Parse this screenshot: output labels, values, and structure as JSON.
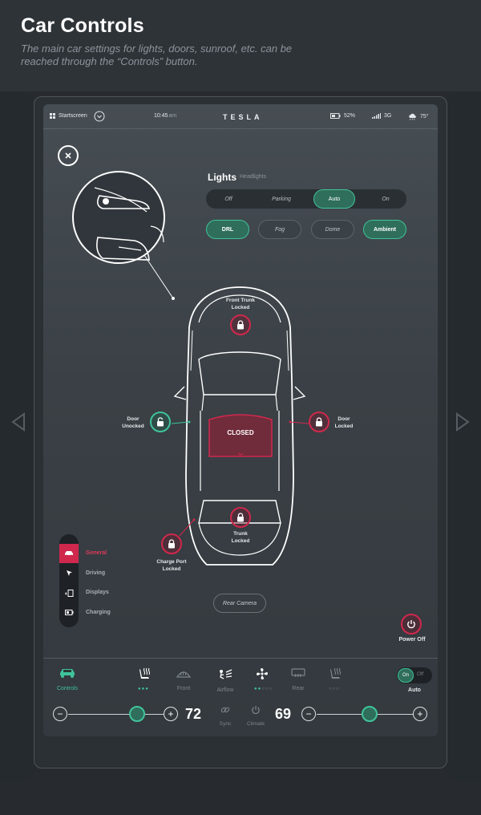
{
  "header": {
    "title": "Car Controls",
    "subtitle_line1": "The main car settings for lights, doors, sunroof, etc. can be",
    "subtitle_line2": "reached through the “Controls” button."
  },
  "status_bar": {
    "startscreen_label": "Startscreen",
    "time": "10:45",
    "time_suffix": "am",
    "brand": "TESLA",
    "battery": "52%",
    "network": "3G",
    "temperature": "75°"
  },
  "lights": {
    "title": "Lights",
    "subtitle": "Headlights",
    "modes": [
      "Off",
      "Parking",
      "Auto",
      "On"
    ],
    "selected_mode": "Auto",
    "buttons": [
      {
        "label": "DRL",
        "on": true
      },
      {
        "label": "Fog",
        "on": false
      },
      {
        "label": "Dome",
        "on": false
      },
      {
        "label": "Ambient",
        "on": true
      }
    ]
  },
  "car": {
    "front_trunk_line1": "Front Trunk",
    "front_trunk_line2": "Locked",
    "left_door_line1": "Door",
    "left_door_line2": "Unocked",
    "right_door_line1": "Door",
    "right_door_line2": "Locked",
    "sunroof": "CLOSED",
    "trunk_line1": "Trunk",
    "trunk_line2": "Locked",
    "charge_port_line1": "Charge Port",
    "charge_port_line2": "Locked"
  },
  "side_menu": {
    "items": [
      "General",
      "Driving",
      "Displays",
      "Charging"
    ],
    "active": "General"
  },
  "rear_camera": "Rear Camera",
  "power_off": "Power Off",
  "dock": {
    "items": [
      "Controls",
      "Front",
      "Airflow",
      "Rear"
    ],
    "auto_toggle": {
      "on_label": "On",
      "off_label": "Off",
      "label": "Auto"
    }
  },
  "climate": {
    "left_temp": "72",
    "right_temp": "69",
    "left_fan_level": 0.72,
    "right_fan_level": 0.55,
    "sync_label": "Sync",
    "climate_label": "Climate"
  },
  "colors": {
    "accent_green": "#3fc39b",
    "accent_red": "#d0284d",
    "background": "#2e3338"
  }
}
